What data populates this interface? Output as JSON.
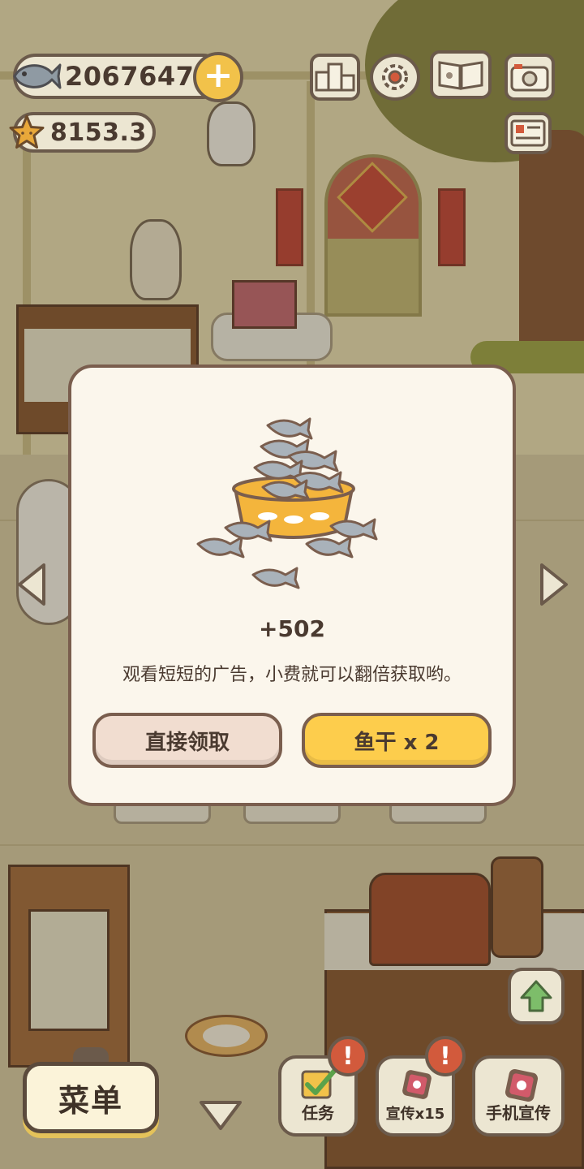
{
  "hud": {
    "fish_count": "2067647",
    "star_rating": "8153.3"
  },
  "top_icons": [
    "ranking-icon",
    "gear-icon",
    "paw-book-icon",
    "camera-icon",
    "notice-card-icon"
  ],
  "reward_dialog": {
    "amount": "+502",
    "description": "观看短短的广告，小费就可以翻倍获取哟。",
    "claim_label": "直接领取",
    "double_label": "鱼干 x 2"
  },
  "bottom_bar": {
    "menu_label": "菜单",
    "tasks_label": "任务",
    "promote_label": "宣传x15",
    "phone_promote_label": "手机宣传",
    "alert_mark": "!"
  },
  "colors": {
    "panel_bg": "#fbf6ec",
    "panel_border": "#7a5e4e",
    "claim_button": "#f1ddd0",
    "double_button": "#fdcd4c",
    "alert": "#d25a3c",
    "text": "#4a3a30"
  }
}
